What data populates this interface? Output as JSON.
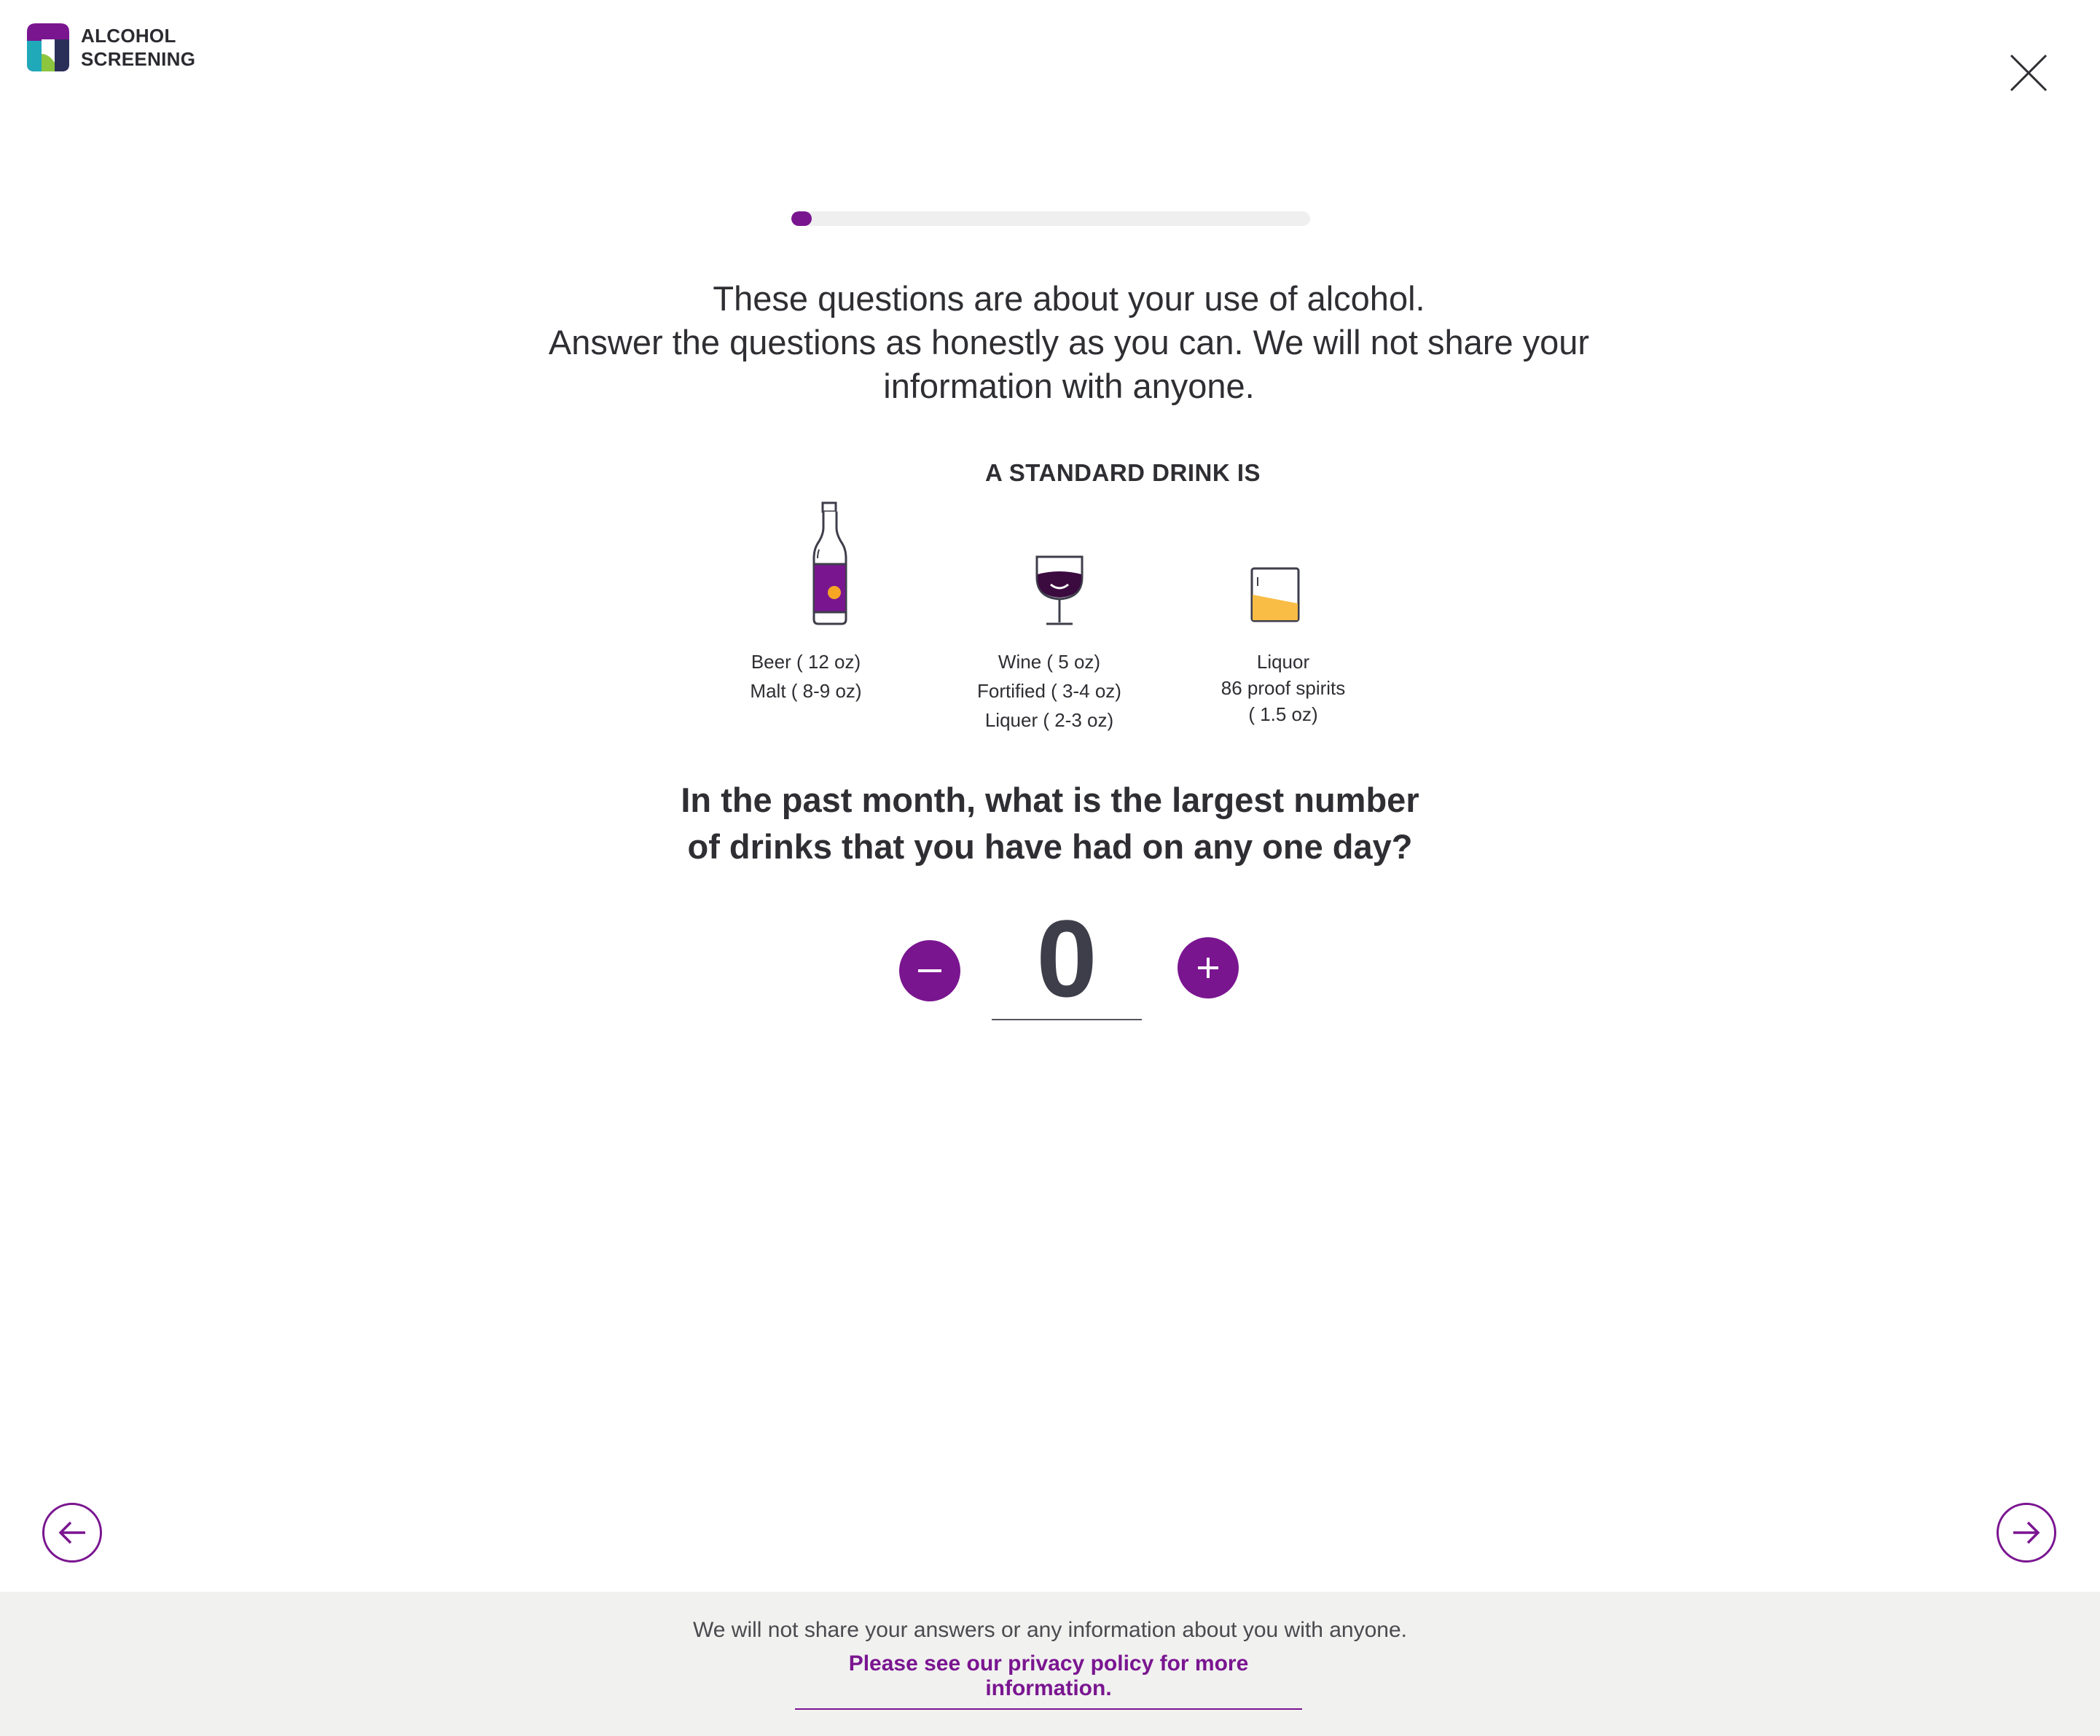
{
  "app": {
    "logo_line1": "ALCOHOL",
    "logo_line2": "SCREENING"
  },
  "progress": {
    "fraction": 0.04
  },
  "intro": {
    "line1": "These questions are about your use of alcohol.",
    "line2": "Answer the questions as honestly as you can. We will not share your",
    "line3": "information with anyone."
  },
  "standard_drink": {
    "title": "A STANDARD DRINK IS",
    "beer": {
      "line1": "Beer ( 12 oz)",
      "line2": "Malt ( 8-9 oz)"
    },
    "wine": {
      "line1": "Wine ( 5 oz)",
      "line2": "Fortified ( 3-4 oz)",
      "line3": "Liquer ( 2-3 oz)"
    },
    "liquor": {
      "line1": "Liquor",
      "line2": "86 proof spirits",
      "line3": "( 1.5 oz)"
    }
  },
  "question": {
    "line1": "In the past month, what is the largest number",
    "line2": "of drinks that you have had on any one day?"
  },
  "stepper": {
    "value": "0"
  },
  "footer": {
    "note": "We will not share your answers or any information about you with anyone.",
    "link": "Please see our privacy policy for more information."
  },
  "colors": {
    "accent": "#7a1590",
    "text": "#2e2e33",
    "footer_bg": "#f1f1f0",
    "liquor_fill": "#f9bd45",
    "wine_fill": "#3b0a3f",
    "logo_teal": "#1fa9b9",
    "logo_green": "#8cc63f",
    "logo_navy": "#2a2f5a"
  },
  "icons": {
    "close": "close-icon",
    "back": "arrow-left-icon",
    "next": "arrow-right-icon",
    "minus": "minus-icon",
    "plus": "plus-icon",
    "beer": "beer-bottle-icon",
    "wine": "wine-glass-icon",
    "liquor": "liquor-glass-icon"
  }
}
